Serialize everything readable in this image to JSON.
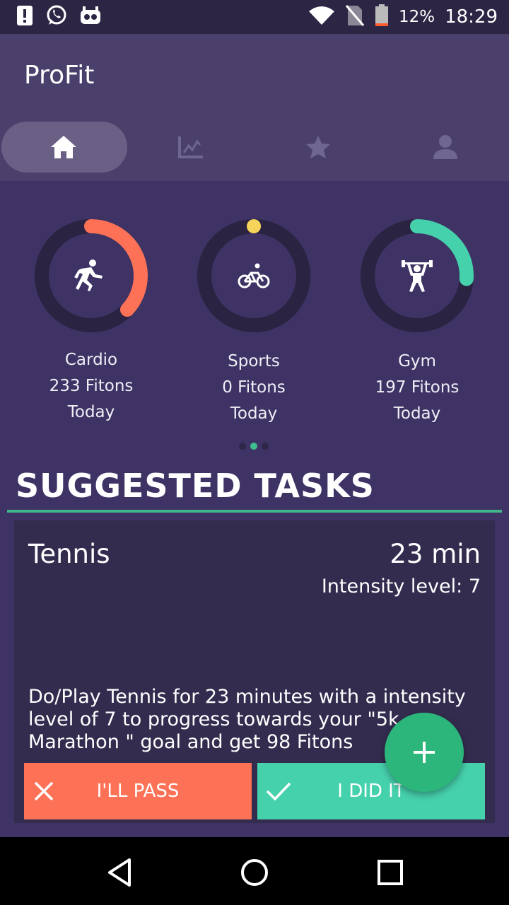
{
  "status_bar": {
    "battery_percent": "12%",
    "time": "18:29",
    "icons": [
      "alert-icon",
      "whatsapp-icon",
      "robot-icon",
      "wifi-icon",
      "no-sim-icon",
      "battery-icon"
    ]
  },
  "app": {
    "title": "ProFit",
    "tabs": [
      {
        "icon": "home-icon",
        "active": true
      },
      {
        "icon": "chart-icon",
        "active": false
      },
      {
        "icon": "star-icon",
        "active": false
      },
      {
        "icon": "profile-icon",
        "active": false
      }
    ]
  },
  "activities": [
    {
      "name": "Cardio",
      "fitons": "233 Fitons",
      "period": "Today",
      "icon": "running-icon",
      "color": "#fd7257",
      "progress": 0.37
    },
    {
      "name": "Sports",
      "fitons": "0 Fitons",
      "period": "Today",
      "icon": "cycling-icon",
      "color": "#f6d35a",
      "progress": 0.0
    },
    {
      "name": "Gym",
      "fitons": "197 Fitons",
      "period": "Today",
      "icon": "weightlifting-icon",
      "color": "#46d1ad",
      "progress": 0.26
    }
  ],
  "pager": {
    "pages": 3,
    "current": 2
  },
  "section": {
    "title": "SUGGESTED TASKS"
  },
  "task": {
    "name": "Tennis",
    "duration": "23 min",
    "intensity": "Intensity level: 7",
    "description": "Do/Play  Tennis for 23 minutes with a intensity level of 7 to progress towards your \"5k Marathon \" goal and get 98 Fitons",
    "pass_label": "I'LL PASS",
    "did_label": "I DID IT"
  },
  "colors": {
    "accent": "#2cb67b",
    "pass": "#fd7257",
    "did": "#46d1ad"
  }
}
